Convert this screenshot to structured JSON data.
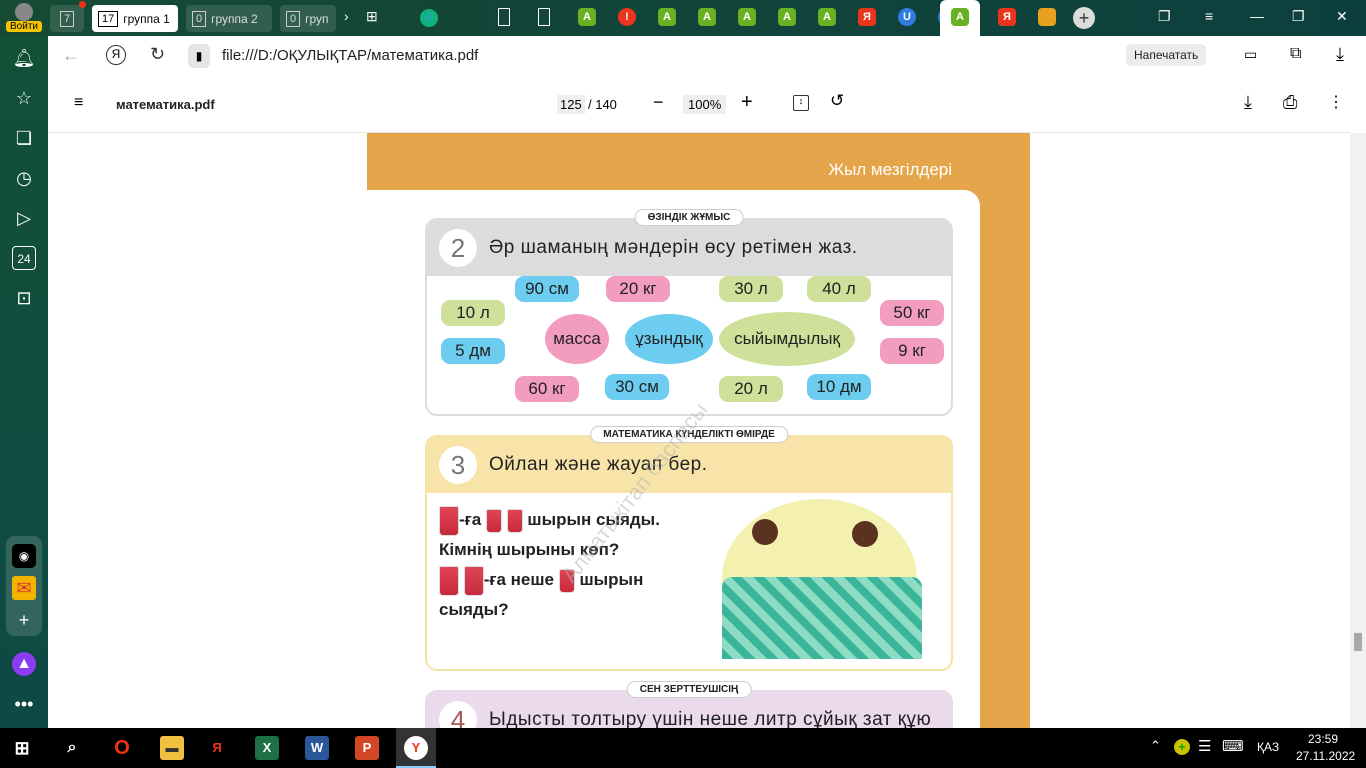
{
  "browser": {
    "login_label": "Войти",
    "home_count": "7",
    "groups": [
      {
        "count": "17",
        "label": "группа 1"
      },
      {
        "count": "0",
        "label": "группа 2"
      },
      {
        "count": "0",
        "label": "груп"
      }
    ],
    "tabs": [
      {
        "icon": "page-icon",
        "letter": "",
        "color": "#ffffff"
      },
      {
        "icon": "page-icon",
        "letter": "",
        "color": "#ffffff"
      },
      {
        "icon": "a-icon",
        "letter": "A",
        "color": "#6ab023"
      },
      {
        "icon": "alert-icon",
        "letter": "!",
        "color": "#e8351c"
      },
      {
        "icon": "a-icon",
        "letter": "A",
        "color": "#6ab023"
      },
      {
        "icon": "a-icon",
        "letter": "A",
        "color": "#6ab023"
      },
      {
        "icon": "a-icon",
        "letter": "A",
        "color": "#6ab023"
      },
      {
        "icon": "a-icon",
        "letter": "A",
        "color": "#6ab023"
      },
      {
        "icon": "a-icon",
        "letter": "A",
        "color": "#6ab023"
      },
      {
        "icon": "yandex-icon",
        "letter": "Я",
        "color": "#e8351c"
      },
      {
        "icon": "u-icon",
        "letter": "U",
        "color": "#2f7be0"
      },
      {
        "icon": "u-icon",
        "letter": "U",
        "color": "#2f7be0"
      },
      {
        "icon": "a-icon",
        "letter": "A",
        "color": "#6ab023"
      },
      {
        "icon": "yandex-icon",
        "letter": "Я",
        "color": "#e8351c"
      },
      {
        "icon": "image-icon",
        "letter": "",
        "color": "#e8a020"
      }
    ],
    "url": "file:///D:/ОҚУЛЫҚТАР/математика.pdf",
    "print_button": "Напечатать"
  },
  "pdf": {
    "filename": "математика.pdf",
    "page_current": "125",
    "page_total": "/ 140",
    "zoom": "100%"
  },
  "page": {
    "header": "Жыл мезгілдері",
    "watermark": "Алматыкітап баспасы",
    "task2": {
      "badge": "ӨЗІНДІК ЖҰМЫС",
      "number": "2",
      "question": "Әр шаманың мәндерін өсу ретімен жаз.",
      "categories": [
        "масса",
        "ұзындық",
        "сыйымдылық"
      ],
      "values": [
        "90 см",
        "20 кг",
        "30 л",
        "40 л",
        "10 л",
        "5 дм",
        "50 кг",
        "9 кг",
        "60 кг",
        "30 см",
        "20 л",
        "10 дм"
      ]
    },
    "task3": {
      "badge": "МАТЕМАТИКА КҮНДЕЛІКТІ ӨМІРДЕ",
      "number": "3",
      "question": "Ойлан және жауап бер.",
      "line1": "-ға",
      "line1b": "шырын сыяды.",
      "line2": "Кімнің шырыны көп?",
      "line3": "-ға неше",
      "line3b": "шырын",
      "line4": "сыяды?"
    },
    "task4": {
      "badge": "СЕН ЗЕРТТЕУШІСІҢ",
      "number": "4",
      "question": "Ыдысты толтыру үшін неше литр сұйық зат құю"
    }
  },
  "taskbar": {
    "lang": "ҚАЗ",
    "time": "23:59",
    "date": "27.11.2022"
  }
}
